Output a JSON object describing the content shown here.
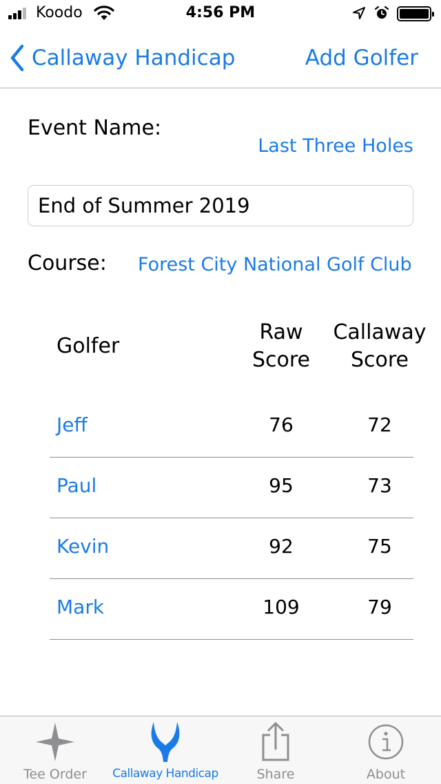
{
  "status_bar": {
    "carrier": "Koodo",
    "time": "4:56 PM"
  },
  "nav": {
    "back_label": "Callaway Handicap",
    "action_label": "Add Golfer"
  },
  "event": {
    "name_label": "Event Name:",
    "mode_link": "Last Three Holes",
    "name_value": "End of Summer 2019",
    "course_label": "Course:",
    "course_value": "Forest City National Golf Club"
  },
  "table": {
    "header_golfer": "Golfer",
    "header_raw_1": "Raw",
    "header_raw_2": "Score",
    "header_call_1": "Callaway",
    "header_call_2": "Score",
    "rows": [
      {
        "name": "Jeff",
        "raw": "76",
        "callaway": "72"
      },
      {
        "name": "Paul",
        "raw": "95",
        "callaway": "73"
      },
      {
        "name": "Kevin",
        "raw": "92",
        "callaway": "75"
      },
      {
        "name": "Mark",
        "raw": "109",
        "callaway": "79"
      }
    ]
  },
  "tabs": [
    {
      "label": "Tee Order",
      "icon": "star-icon"
    },
    {
      "label": "Callaway Handicap",
      "icon": "horns-icon"
    },
    {
      "label": "Share",
      "icon": "share-icon"
    },
    {
      "label": "About",
      "icon": "info-icon"
    }
  ],
  "colors": {
    "accent": "#1b7be6",
    "tab_inactive": "#8e8e93"
  }
}
